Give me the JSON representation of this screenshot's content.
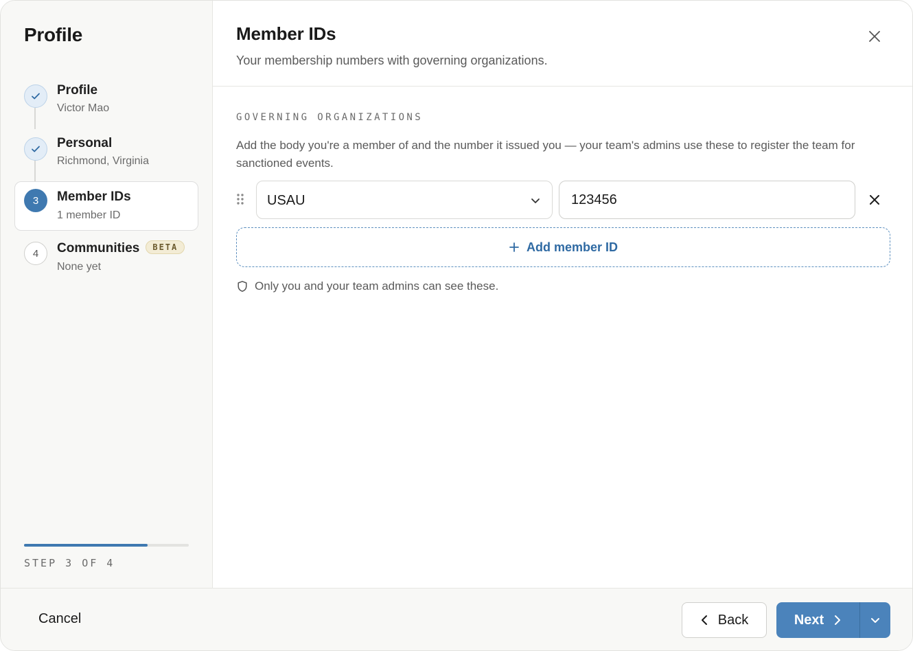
{
  "sidebar": {
    "title": "Profile",
    "steps": [
      {
        "label": "Profile",
        "sub": "Victor Mao",
        "state": "done"
      },
      {
        "label": "Personal",
        "sub": "Richmond, Virginia",
        "state": "done"
      },
      {
        "number": "3",
        "label": "Member IDs",
        "sub": "1 member ID",
        "state": "current"
      },
      {
        "number": "4",
        "label": "Communities",
        "badge": "BETA",
        "sub": "None yet",
        "state": "todo"
      }
    ],
    "progress_fraction": 0.75,
    "step_counter": "STEP 3 OF 4"
  },
  "main": {
    "title": "Member IDs",
    "subtitle": "Your membership numbers with governing organizations.",
    "section_label": "GOVERNING ORGANIZATIONS",
    "section_description": "Add the body you're a member of and the number it issued you — your team's admins use these to register the team for sanctioned events.",
    "member_rows": [
      {
        "organization": "USAU",
        "member_number": "123456"
      }
    ],
    "add_button_label": "Add member ID",
    "privacy_note": "Only you and your team admins can see these."
  },
  "footer": {
    "cancel_label": "Cancel",
    "back_label": "Back",
    "next_label": "Next"
  },
  "colors": {
    "accent": "#4b83bb",
    "accent_dark": "#3f79b0",
    "link": "#2f6aa3",
    "sidebar_bg": "#f8f8f6"
  },
  "icons": [
    "check-icon",
    "close-icon",
    "chevron-down-icon",
    "drag-handle-icon",
    "plus-icon",
    "shield-icon",
    "chevron-left-icon",
    "chevron-right-icon"
  ]
}
